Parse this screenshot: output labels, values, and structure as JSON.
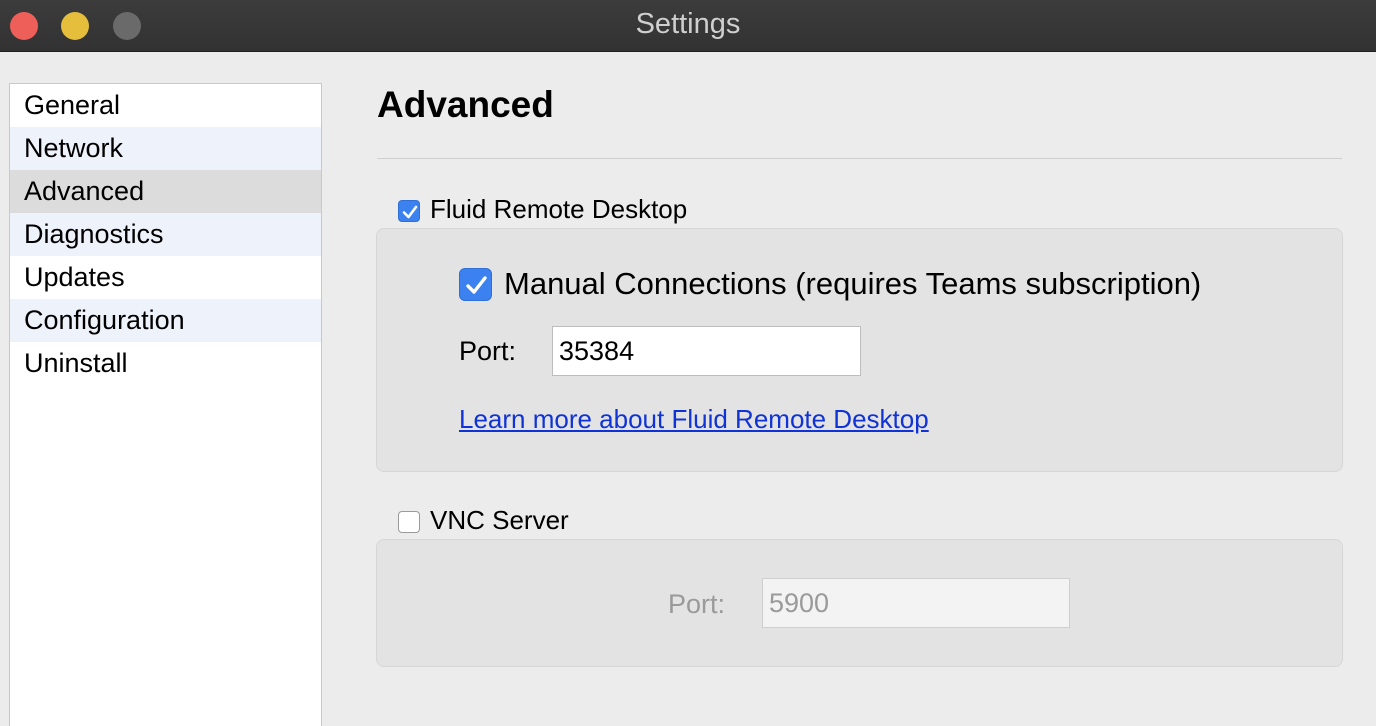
{
  "window": {
    "title": "Settings"
  },
  "sidebar": {
    "items": [
      {
        "label": "General"
      },
      {
        "label": "Network"
      },
      {
        "label": "Advanced",
        "selected": true
      },
      {
        "label": "Diagnostics"
      },
      {
        "label": "Updates"
      },
      {
        "label": "Configuration"
      },
      {
        "label": "Uninstall"
      }
    ]
  },
  "main": {
    "heading": "Advanced",
    "fluid": {
      "enabled": true,
      "label": "Fluid Remote Desktop",
      "manual_connections": {
        "checked": true,
        "label": "Manual Connections (requires Teams subscription)"
      },
      "port_label": "Port:",
      "port_value": "35384",
      "learn_more_link": "Learn more about Fluid Remote Desktop"
    },
    "vnc": {
      "enabled": false,
      "label": "VNC Server",
      "port_label": "Port:",
      "port_value": "5900"
    }
  },
  "colors": {
    "accent": "#3b82f0",
    "link": "#0f33d6",
    "close_button": "#ee5f5a",
    "minimize_button": "#e5bf3c",
    "zoom_button": "#6a6a6a"
  }
}
